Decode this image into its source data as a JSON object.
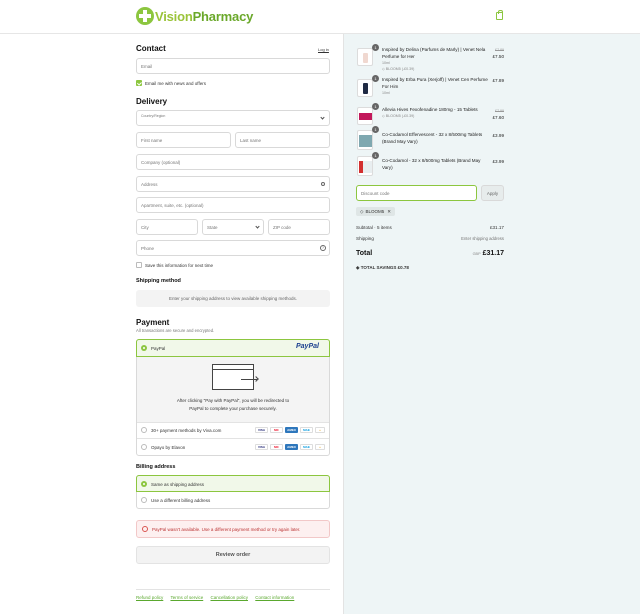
{
  "brand": {
    "name_a": "Vision",
    "name_b": "Pharmacy"
  },
  "contact": {
    "title": "Contact",
    "login_link": "Log in",
    "email_placeholder": "Email",
    "news_label": "Email me with news and offers"
  },
  "delivery": {
    "title": "Delivery",
    "country_label": "Country/Region",
    "first_name": "First name",
    "last_name": "Last name",
    "company": "Company (optional)",
    "address": "Address",
    "apartment": "Apartment, suite, etc. (optional)",
    "city": "City",
    "state": "State",
    "zip": "ZIP code",
    "phone": "Phone",
    "save_label": "Save this information for next time"
  },
  "shipping_method": {
    "title": "Shipping method",
    "message": "Enter your shipping address to view available shipping methods."
  },
  "payment": {
    "title": "Payment",
    "subtitle": "All transactions are secure and encrypted.",
    "paypal_label": "PayPal",
    "paypal_logo": "PayPal",
    "redirect_text_1": "After clicking \"Pay with PayPal\", you will be redirected to",
    "redirect_text_2": "PayPal to complete your purchase securely.",
    "option2_label": "30+ payment methods by Viva.com",
    "option3_label": "Opayo by Elavon",
    "card_labels": [
      "VISA",
      "MC",
      "AMEX",
      "MAE",
      "+"
    ]
  },
  "billing": {
    "title": "Billing address",
    "same": "Same as shipping address",
    "different": "Use a different billing address"
  },
  "error": {
    "message": "PayPal wasn't available. Use a different payment method or try again later."
  },
  "review_button": "Review order",
  "footer": [
    "Refund policy",
    "Terms of service",
    "Cancellation policy",
    "Contact information"
  ],
  "cart": {
    "items": [
      {
        "qty": "1",
        "title": "Inspired by Delina (Parfums de Marly) | Venet Nela Perfume for Her",
        "meta": "10ml",
        "discount": "BLOOM5 (-£0.39)",
        "old_price": "£7.89",
        "price": "£7.50"
      },
      {
        "qty": "1",
        "title": "Inspired by Erba Pura (Xerjoff) | Venet Cen Perfume For Him",
        "meta": "10ml",
        "discount": "",
        "old_price": "",
        "price": "£7.89"
      },
      {
        "qty": "1",
        "title": "Allevia Hives Fexofenadine 180mg - 15 Tablets",
        "meta": "",
        "discount": "BLOOM5 (-£0.39)",
        "old_price": "£7.99",
        "price": "£7.60"
      },
      {
        "qty": "1",
        "title": "Co-Codamol Effervescent - 32 x 8/500mg Tablets (Brand May Vary)",
        "meta": "",
        "discount": "",
        "old_price": "",
        "price": "£3.99"
      },
      {
        "qty": "1",
        "title": "Co-Codamol - 32 x 8/500mg Tablets (Brand May Vary)",
        "meta": "",
        "discount": "",
        "old_price": "",
        "price": "£3.99"
      }
    ],
    "discount_placeholder": "Discount code",
    "apply_label": "Apply",
    "applied_code": "BLOOM5",
    "subtotal_label": "Subtotal · 5 items",
    "subtotal_value": "£31.17",
    "shipping_label": "Shipping",
    "shipping_value": "Enter shipping address",
    "total_label": "Total",
    "currency": "GBP",
    "total_value": "£31.17",
    "savings_label": "TOTAL SAVINGS",
    "savings_value": "£0.78"
  },
  "colors": {
    "accent": "#8cc63f",
    "panel": "#eef5f6",
    "error_bg": "#fdf0f0",
    "error_icon": "#d9534f",
    "paypal_blue": "#1b3f8f"
  }
}
